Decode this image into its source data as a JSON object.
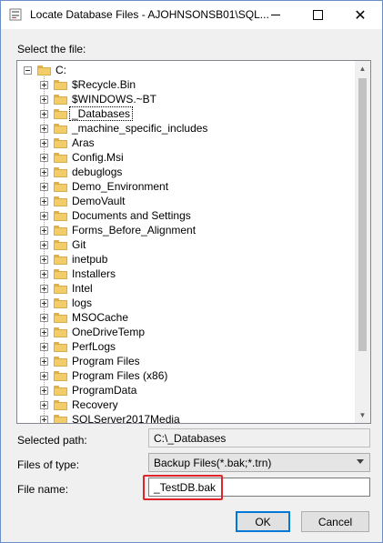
{
  "window": {
    "title": "Locate Database Files - AJOHNSONSB01\\SQL...",
    "close_glyph": "✕"
  },
  "tree": {
    "label": "Select the file:",
    "root": "C:",
    "items": [
      {
        "label": "$Recycle.Bin",
        "selected": false
      },
      {
        "label": "$WINDOWS.~BT",
        "selected": false
      },
      {
        "label": "_Databases",
        "selected": true
      },
      {
        "label": "_machine_specific_includes",
        "selected": false
      },
      {
        "label": "Aras",
        "selected": false
      },
      {
        "label": "Config.Msi",
        "selected": false
      },
      {
        "label": "debuglogs",
        "selected": false
      },
      {
        "label": "Demo_Environment",
        "selected": false
      },
      {
        "label": "DemoVault",
        "selected": false
      },
      {
        "label": "Documents and Settings",
        "selected": false
      },
      {
        "label": "Forms_Before_Alignment",
        "selected": false
      },
      {
        "label": "Git",
        "selected": false
      },
      {
        "label": "inetpub",
        "selected": false
      },
      {
        "label": "Installers",
        "selected": false
      },
      {
        "label": "Intel",
        "selected": false
      },
      {
        "label": "logs",
        "selected": false
      },
      {
        "label": "MSOCache",
        "selected": false
      },
      {
        "label": "OneDriveTemp",
        "selected": false
      },
      {
        "label": "PerfLogs",
        "selected": false
      },
      {
        "label": "Program Files",
        "selected": false
      },
      {
        "label": "Program Files (x86)",
        "selected": false
      },
      {
        "label": "ProgramData",
        "selected": false
      },
      {
        "label": "Recovery",
        "selected": false
      },
      {
        "label": "SQLServer2017Media",
        "selected": false
      }
    ],
    "scroll_up_glyph": "▲",
    "scroll_down_glyph": "▼"
  },
  "form": {
    "selected_path_label": "Selected path:",
    "selected_path_value": "C:\\_Databases",
    "files_of_type_label": "Files of type:",
    "files_of_type_value": "Backup Files(*.bak;*.trn)",
    "file_name_label": "File name:",
    "file_name_value": "_TestDB.bak"
  },
  "buttons": {
    "ok": "OK",
    "cancel": "Cancel"
  },
  "colors": {
    "highlight": "#e0242a",
    "default_button_border": "#0078d7"
  }
}
